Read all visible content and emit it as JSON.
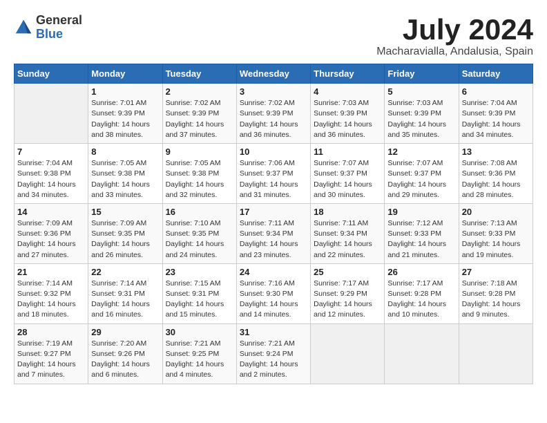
{
  "logo": {
    "text_top": "General",
    "text_bottom": "Blue"
  },
  "title": "July 2024",
  "subtitle": "Macharavialla, Andalusia, Spain",
  "header_days": [
    "Sunday",
    "Monday",
    "Tuesday",
    "Wednesday",
    "Thursday",
    "Friday",
    "Saturday"
  ],
  "weeks": [
    [
      {
        "day": "",
        "empty": true
      },
      {
        "day": "1",
        "sunrise": "Sunrise: 7:01 AM",
        "sunset": "Sunset: 9:39 PM",
        "daylight": "Daylight: 14 hours and 38 minutes."
      },
      {
        "day": "2",
        "sunrise": "Sunrise: 7:02 AM",
        "sunset": "Sunset: 9:39 PM",
        "daylight": "Daylight: 14 hours and 37 minutes."
      },
      {
        "day": "3",
        "sunrise": "Sunrise: 7:02 AM",
        "sunset": "Sunset: 9:39 PM",
        "daylight": "Daylight: 14 hours and 36 minutes."
      },
      {
        "day": "4",
        "sunrise": "Sunrise: 7:03 AM",
        "sunset": "Sunset: 9:39 PM",
        "daylight": "Daylight: 14 hours and 36 minutes."
      },
      {
        "day": "5",
        "sunrise": "Sunrise: 7:03 AM",
        "sunset": "Sunset: 9:39 PM",
        "daylight": "Daylight: 14 hours and 35 minutes."
      },
      {
        "day": "6",
        "sunrise": "Sunrise: 7:04 AM",
        "sunset": "Sunset: 9:39 PM",
        "daylight": "Daylight: 14 hours and 34 minutes."
      }
    ],
    [
      {
        "day": "7",
        "sunrise": "Sunrise: 7:04 AM",
        "sunset": "Sunset: 9:38 PM",
        "daylight": "Daylight: 14 hours and 34 minutes."
      },
      {
        "day": "8",
        "sunrise": "Sunrise: 7:05 AM",
        "sunset": "Sunset: 9:38 PM",
        "daylight": "Daylight: 14 hours and 33 minutes."
      },
      {
        "day": "9",
        "sunrise": "Sunrise: 7:05 AM",
        "sunset": "Sunset: 9:38 PM",
        "daylight": "Daylight: 14 hours and 32 minutes."
      },
      {
        "day": "10",
        "sunrise": "Sunrise: 7:06 AM",
        "sunset": "Sunset: 9:37 PM",
        "daylight": "Daylight: 14 hours and 31 minutes."
      },
      {
        "day": "11",
        "sunrise": "Sunrise: 7:07 AM",
        "sunset": "Sunset: 9:37 PM",
        "daylight": "Daylight: 14 hours and 30 minutes."
      },
      {
        "day": "12",
        "sunrise": "Sunrise: 7:07 AM",
        "sunset": "Sunset: 9:37 PM",
        "daylight": "Daylight: 14 hours and 29 minutes."
      },
      {
        "day": "13",
        "sunrise": "Sunrise: 7:08 AM",
        "sunset": "Sunset: 9:36 PM",
        "daylight": "Daylight: 14 hours and 28 minutes."
      }
    ],
    [
      {
        "day": "14",
        "sunrise": "Sunrise: 7:09 AM",
        "sunset": "Sunset: 9:36 PM",
        "daylight": "Daylight: 14 hours and 27 minutes."
      },
      {
        "day": "15",
        "sunrise": "Sunrise: 7:09 AM",
        "sunset": "Sunset: 9:35 PM",
        "daylight": "Daylight: 14 hours and 26 minutes."
      },
      {
        "day": "16",
        "sunrise": "Sunrise: 7:10 AM",
        "sunset": "Sunset: 9:35 PM",
        "daylight": "Daylight: 14 hours and 24 minutes."
      },
      {
        "day": "17",
        "sunrise": "Sunrise: 7:11 AM",
        "sunset": "Sunset: 9:34 PM",
        "daylight": "Daylight: 14 hours and 23 minutes."
      },
      {
        "day": "18",
        "sunrise": "Sunrise: 7:11 AM",
        "sunset": "Sunset: 9:34 PM",
        "daylight": "Daylight: 14 hours and 22 minutes."
      },
      {
        "day": "19",
        "sunrise": "Sunrise: 7:12 AM",
        "sunset": "Sunset: 9:33 PM",
        "daylight": "Daylight: 14 hours and 21 minutes."
      },
      {
        "day": "20",
        "sunrise": "Sunrise: 7:13 AM",
        "sunset": "Sunset: 9:33 PM",
        "daylight": "Daylight: 14 hours and 19 minutes."
      }
    ],
    [
      {
        "day": "21",
        "sunrise": "Sunrise: 7:14 AM",
        "sunset": "Sunset: 9:32 PM",
        "daylight": "Daylight: 14 hours and 18 minutes."
      },
      {
        "day": "22",
        "sunrise": "Sunrise: 7:14 AM",
        "sunset": "Sunset: 9:31 PM",
        "daylight": "Daylight: 14 hours and 16 minutes."
      },
      {
        "day": "23",
        "sunrise": "Sunrise: 7:15 AM",
        "sunset": "Sunset: 9:31 PM",
        "daylight": "Daylight: 14 hours and 15 minutes."
      },
      {
        "day": "24",
        "sunrise": "Sunrise: 7:16 AM",
        "sunset": "Sunset: 9:30 PM",
        "daylight": "Daylight: 14 hours and 14 minutes."
      },
      {
        "day": "25",
        "sunrise": "Sunrise: 7:17 AM",
        "sunset": "Sunset: 9:29 PM",
        "daylight": "Daylight: 14 hours and 12 minutes."
      },
      {
        "day": "26",
        "sunrise": "Sunrise: 7:17 AM",
        "sunset": "Sunset: 9:28 PM",
        "daylight": "Daylight: 14 hours and 10 minutes."
      },
      {
        "day": "27",
        "sunrise": "Sunrise: 7:18 AM",
        "sunset": "Sunset: 9:28 PM",
        "daylight": "Daylight: 14 hours and 9 minutes."
      }
    ],
    [
      {
        "day": "28",
        "sunrise": "Sunrise: 7:19 AM",
        "sunset": "Sunset: 9:27 PM",
        "daylight": "Daylight: 14 hours and 7 minutes."
      },
      {
        "day": "29",
        "sunrise": "Sunrise: 7:20 AM",
        "sunset": "Sunset: 9:26 PM",
        "daylight": "Daylight: 14 hours and 6 minutes."
      },
      {
        "day": "30",
        "sunrise": "Sunrise: 7:21 AM",
        "sunset": "Sunset: 9:25 PM",
        "daylight": "Daylight: 14 hours and 4 minutes."
      },
      {
        "day": "31",
        "sunrise": "Sunrise: 7:21 AM",
        "sunset": "Sunset: 9:24 PM",
        "daylight": "Daylight: 14 hours and 2 minutes."
      },
      {
        "day": "",
        "empty": true
      },
      {
        "day": "",
        "empty": true
      },
      {
        "day": "",
        "empty": true
      }
    ]
  ]
}
